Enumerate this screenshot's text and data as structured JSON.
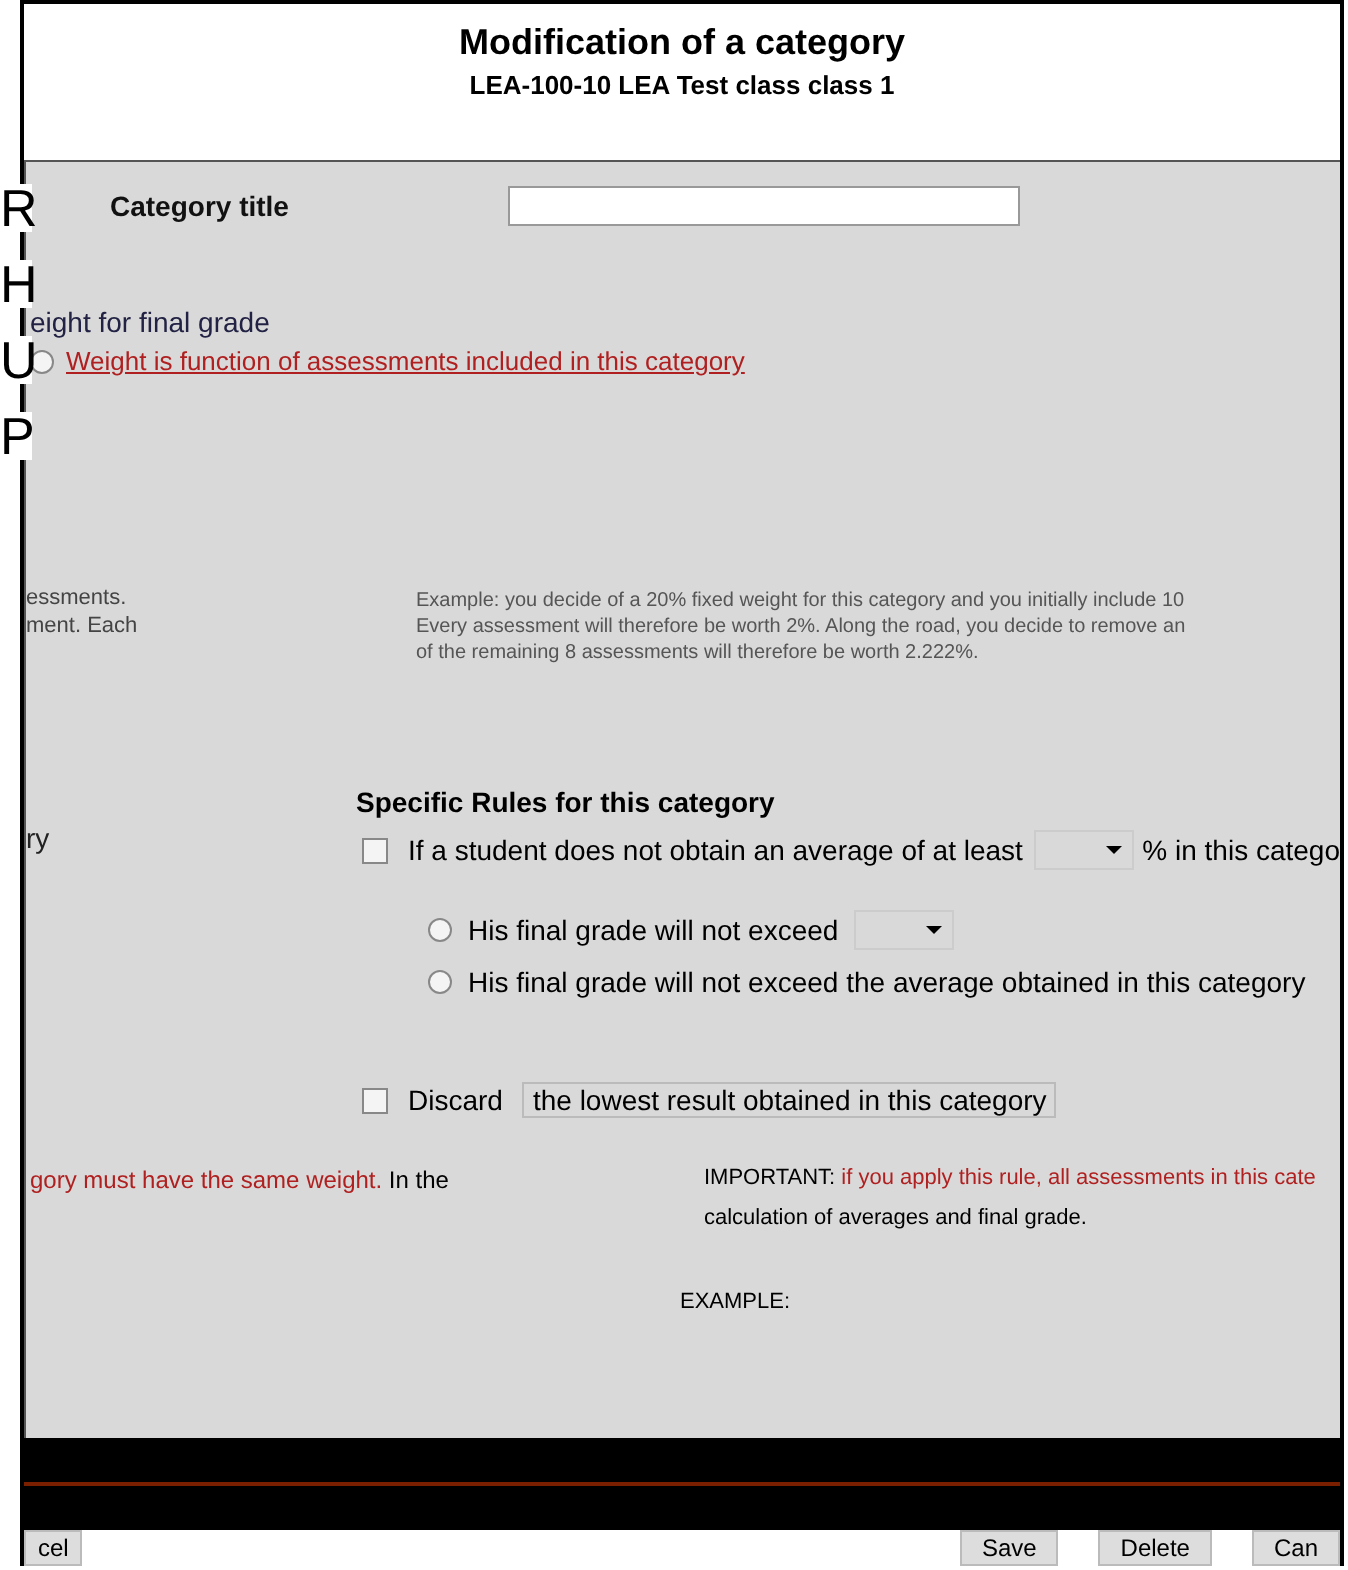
{
  "background_letters": [
    "R",
    "H",
    "U",
    "P"
  ],
  "dialog": {
    "title": "Modification of a category",
    "subtitle": "LEA-100-10 LEA Test class class 1"
  },
  "category_title": {
    "label": "Category title"
  },
  "weight": {
    "label": "eight for final grade",
    "options": [
      {
        "label": "Weight is function of assessments included in this category",
        "selected": false
      }
    ]
  },
  "left_fragments": [
    "essments.",
    "ment. Each"
  ],
  "example_lines": [
    "Example: you decide of a 20% fixed weight for this category and you initially include 10",
    "Every assessment will therefore be worth 2%. Along the road, you decide to remove an",
    "of the remaining 8 assessments will therefore be worth 2.222%."
  ],
  "rules": {
    "heading": "Specific Rules for this category",
    "left_fragment": "ry",
    "minimum": {
      "checked": false,
      "before": "If a student does not obtain an average of at least",
      "after": "% in this catego"
    },
    "options": [
      {
        "label": "His final grade will not exceed",
        "kind": "dropdown",
        "selected": false
      },
      {
        "label": "His final grade will not exceed the average obtained in this category",
        "kind": "plain",
        "selected": false
      }
    ]
  },
  "discard": {
    "checked": false,
    "label": "Discard",
    "select_value": "the lowest result obtained in this category"
  },
  "left_note": {
    "highlight": "gory must have the same weight.",
    "rest": "In the"
  },
  "right_note": {
    "lead": "IMPORTANT:",
    "highlight": "if you apply this rule, all assessments in this cate",
    "line2": "calculation of averages and final grade."
  },
  "example_note": "EXAMPLE:",
  "buttons": [
    {
      "label": "cel"
    },
    {
      "label": "Save"
    },
    {
      "label": "Delete"
    },
    {
      "label": "Can"
    }
  ]
}
